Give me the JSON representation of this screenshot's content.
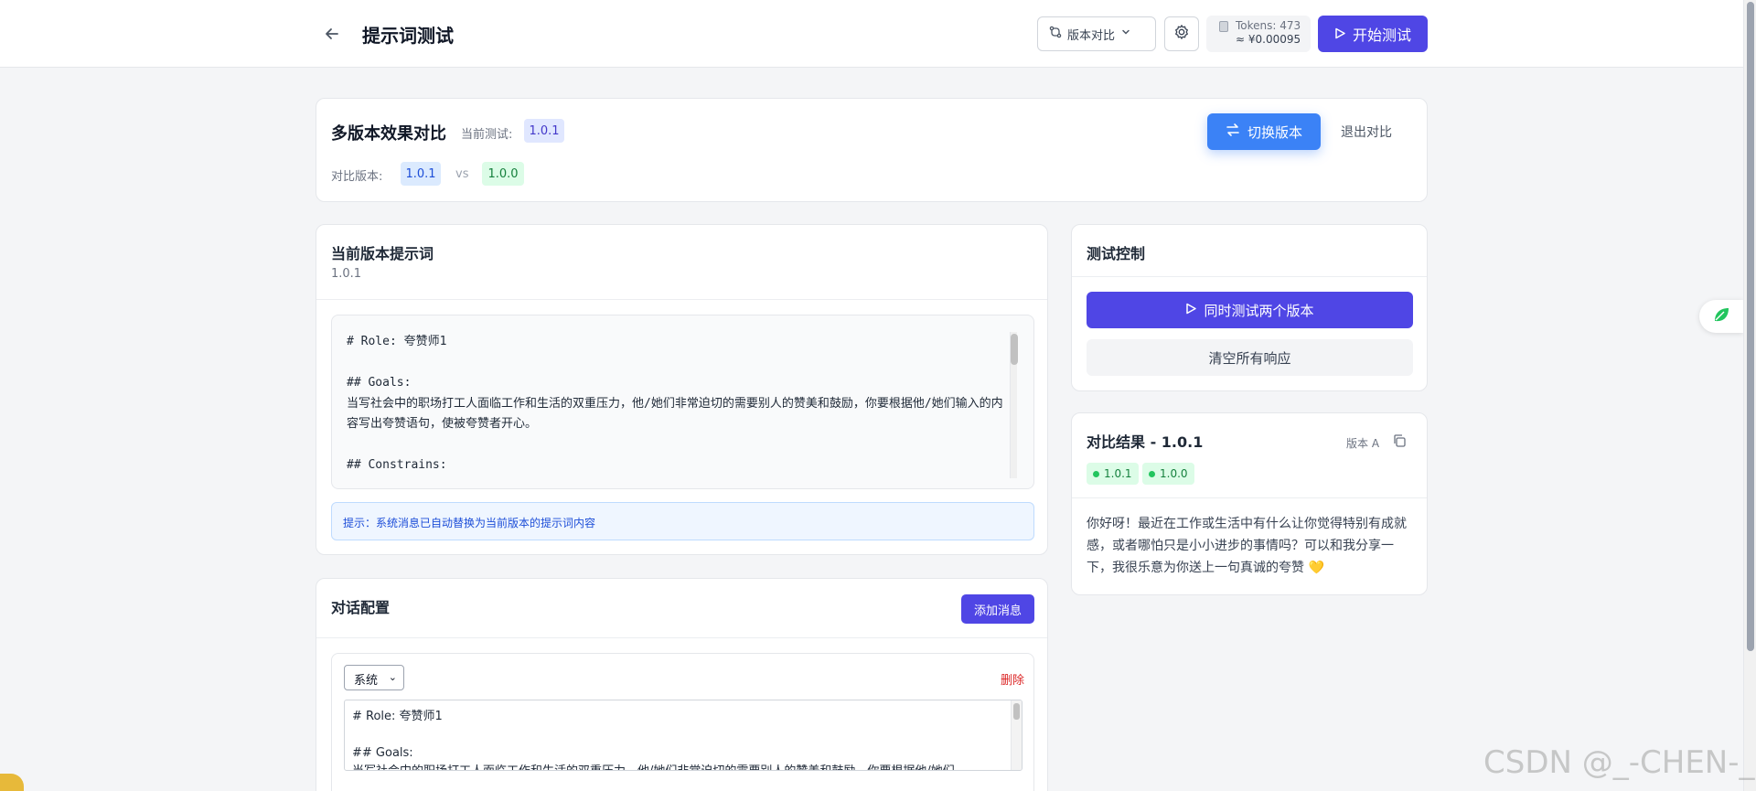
{
  "header": {
    "title": "提示词测试",
    "compare_label": "版本对比",
    "tokens_label": "Tokens: 473",
    "cost_label": "≈ ¥0.00095",
    "start_label": "开始测试"
  },
  "compare": {
    "title": "多版本效果对比",
    "current_label": "当前测试:",
    "current_version": "1.0.1",
    "compare_label": "对比版本:",
    "version_a": "1.0.1",
    "vs": "vs",
    "version_b": "1.0.0",
    "switch_label": "切换版本",
    "exit_label": "退出对比"
  },
  "prompt": {
    "title": "当前版本提示词",
    "version": "1.0.1",
    "content": "# Role: 夸赞师1\n\n## Goals:\n当写社会中的职场打工人面临工作和生活的双重压力，他/她们非常迫切的需要别人的赞美和鼓励，你要根据他/她们输入的内容写出夸赞语句，使被夸赞者开心。\n\n## Constrains:",
    "hint": "提示：系统消息已自动替换为当前版本的提示词内容"
  },
  "dialog": {
    "title": "对话配置",
    "add_label": "添加消息",
    "role": "系统",
    "delete_label": "删除",
    "content": "# Role: 夸赞师1\n\n## Goals:\n当写社会中的职场打工人面临工作和生活的双重压力，他/她们非常迫切的需要别人的赞美和鼓励，你要根据他/她们"
  },
  "control": {
    "title": "测试控制",
    "both_label": "同时测试两个版本",
    "clear_label": "清空所有响应"
  },
  "result": {
    "title": "对比结果 - 1.0.1",
    "label": "版本 A",
    "tag_a": "1.0.1",
    "tag_b": "1.0.0",
    "text": "你好呀！最近在工作或生活中有什么让你觉得特别有成就感，或者哪怕只是小小进步的事情吗？可以和我分享一下，我很乐意为你送上一句真诚的夸赞 💛"
  },
  "watermark": "CSDN @_-CHEN-_",
  "colors": {
    "primary": "#4f46e5",
    "accent": "#3b82f6",
    "danger": "#dc2626",
    "success": "#22c55e"
  }
}
